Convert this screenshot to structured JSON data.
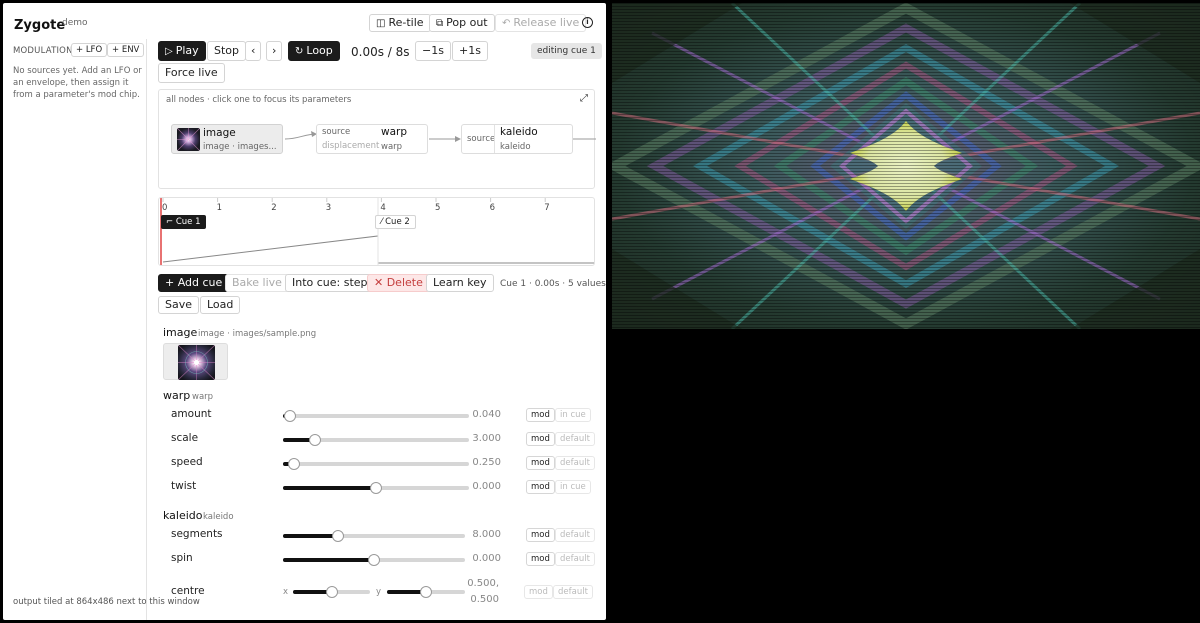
{
  "app": {
    "title": "Zygote",
    "subtitle": "demo"
  },
  "header": {
    "retile_label": "Re-tile",
    "popout_label": "Pop out",
    "release_label": "Release live"
  },
  "sidebar": {
    "modulation_label": "MODULATION",
    "lfo_label": "+ LFO",
    "env_label": "+ ENV",
    "empty_text": "No sources yet. Add an LFO or an envelope, then assign it from a parameter's mod chip.",
    "footer": "output tiled at 864x486 next to this window"
  },
  "transport": {
    "play": "Play",
    "stop": "Stop",
    "prev": "‹",
    "next": "›",
    "loop": "Loop",
    "time": "0.00s / 8s",
    "back": "−1s",
    "forward": "+1s",
    "editing": "editing cue 1",
    "force_live": "Force live"
  },
  "graph": {
    "hint": "all nodes · click one to focus its parameters",
    "nodes": [
      {
        "title": "image",
        "sub": "image · images...",
        "selected": true
      },
      {
        "title": "warp",
        "sub": "warp",
        "ports": [
          "source",
          "displacement"
        ]
      },
      {
        "title": "kaleido",
        "sub": "kaleido",
        "ports": [
          "source"
        ]
      }
    ]
  },
  "timeline": {
    "ticks": [
      "0",
      "1",
      "2",
      "3",
      "4",
      "5",
      "6",
      "7"
    ],
    "duration": 8,
    "cues": [
      {
        "label": "Cue 1",
        "time": 0,
        "icon": "⌐",
        "active": true
      },
      {
        "label": "Cue 2",
        "time": 4,
        "icon": "⁄",
        "active": false
      }
    ]
  },
  "cue_actions": {
    "add": "+ Add cue",
    "bake": "Bake live",
    "into": "Into cue: step",
    "delete": "✕ Delete",
    "learn": "Learn key",
    "status": "Cue 1 · 0.00s · 5 values",
    "save": "Save",
    "load": "Load"
  },
  "params": {
    "image": {
      "title": "image",
      "sub": "image · images/sample.png"
    },
    "warp": {
      "title": "warp",
      "sub": "warp",
      "rows": [
        {
          "label": "amount",
          "value": "0.040",
          "fill": 0.04,
          "mod": "mod",
          "tag": "in cue"
        },
        {
          "label": "scale",
          "value": "3.000",
          "fill": 0.17,
          "mod": "mod",
          "tag": "default"
        },
        {
          "label": "speed",
          "value": "0.250",
          "fill": 0.06,
          "mod": "mod",
          "tag": "default"
        },
        {
          "label": "twist",
          "value": "0.000",
          "fill": 0.5,
          "mod": "mod",
          "tag": "in cue"
        }
      ]
    },
    "kaleido": {
      "title": "kaleido",
      "sub": "kaleido",
      "rows": [
        {
          "label": "segments",
          "value": "8.000",
          "fill": 0.3,
          "mod": "mod",
          "tag": "default"
        },
        {
          "label": "spin",
          "value": "0.000",
          "fill": 0.5,
          "mod": "mod",
          "tag": "default"
        }
      ],
      "centre": {
        "label": "centre",
        "x_label": "x",
        "y_label": "y",
        "x_fill": 0.5,
        "y_fill": 0.5,
        "value_line1": "0.500,",
        "value_line2": "0.500",
        "mod": "mod",
        "tag": "default"
      }
    }
  }
}
